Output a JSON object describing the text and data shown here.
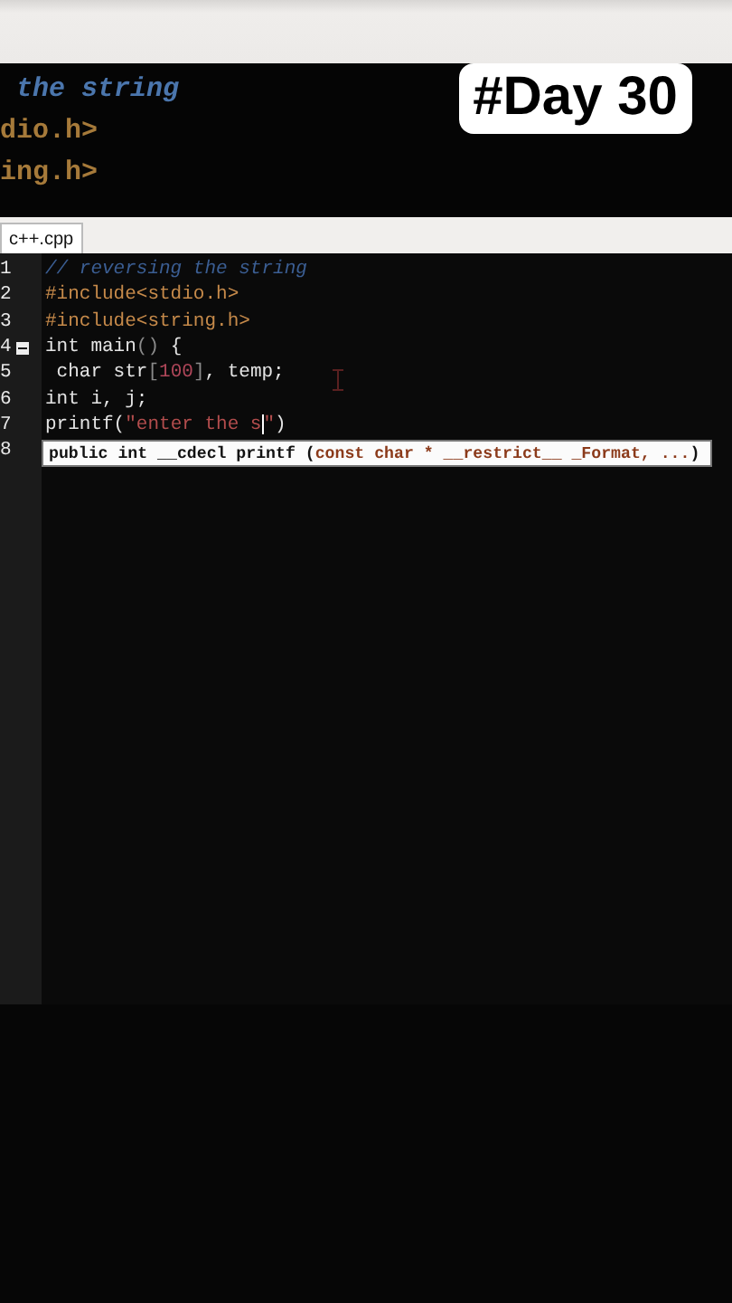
{
  "backdrop_lines": [
    {
      "text": " the string",
      "kind": "comment"
    },
    {
      "text": "dio.h>",
      "kind": "include"
    },
    {
      "text": "ing.h>",
      "kind": "include"
    }
  ],
  "badge": "#Day 30",
  "tab": {
    "label": "c++.cpp",
    "selected": true
  },
  "lines": [
    {
      "number": "1",
      "tokens": [
        {
          "text": "// reversing the string",
          "kind": "comment"
        }
      ]
    },
    {
      "number": "2",
      "tokens": [
        {
          "text": "#include<stdio.h>",
          "kind": "include"
        }
      ]
    },
    {
      "number": "3",
      "tokens": [
        {
          "text": "#include<string.h>",
          "kind": "include"
        }
      ]
    },
    {
      "number": "4",
      "expanded": true,
      "tokens": [
        {
          "text": "int main",
          "kind": "plain"
        },
        {
          "text": "()",
          "kind": "punct"
        },
        {
          "text": " {",
          "kind": "plain"
        }
      ]
    },
    {
      "number": "5",
      "tokens": [
        {
          "text": " char str",
          "kind": "plain"
        },
        {
          "text": "[",
          "kind": "punct"
        },
        {
          "text": "100",
          "kind": "number"
        },
        {
          "text": "]",
          "kind": "punct"
        },
        {
          "text": ", temp;",
          "kind": "plain"
        }
      ]
    },
    {
      "number": "6",
      "tokens": [
        {
          "text": "int i, j;",
          "kind": "plain"
        }
      ]
    },
    {
      "number": "7",
      "tokens": [
        {
          "text": "printf(",
          "kind": "plain"
        },
        {
          "text": "\"enter the s",
          "kind": "string"
        },
        {
          "kind": "cursor"
        },
        {
          "text": "\"",
          "kind": "string"
        },
        {
          "text": ")",
          "kind": "plain"
        }
      ]
    },
    {
      "number": "8"
    }
  ],
  "tooltip": {
    "prefix": "public int __cdecl printf (",
    "params": "const char * __restrict__ _Format, ...",
    "suffix": ")"
  }
}
